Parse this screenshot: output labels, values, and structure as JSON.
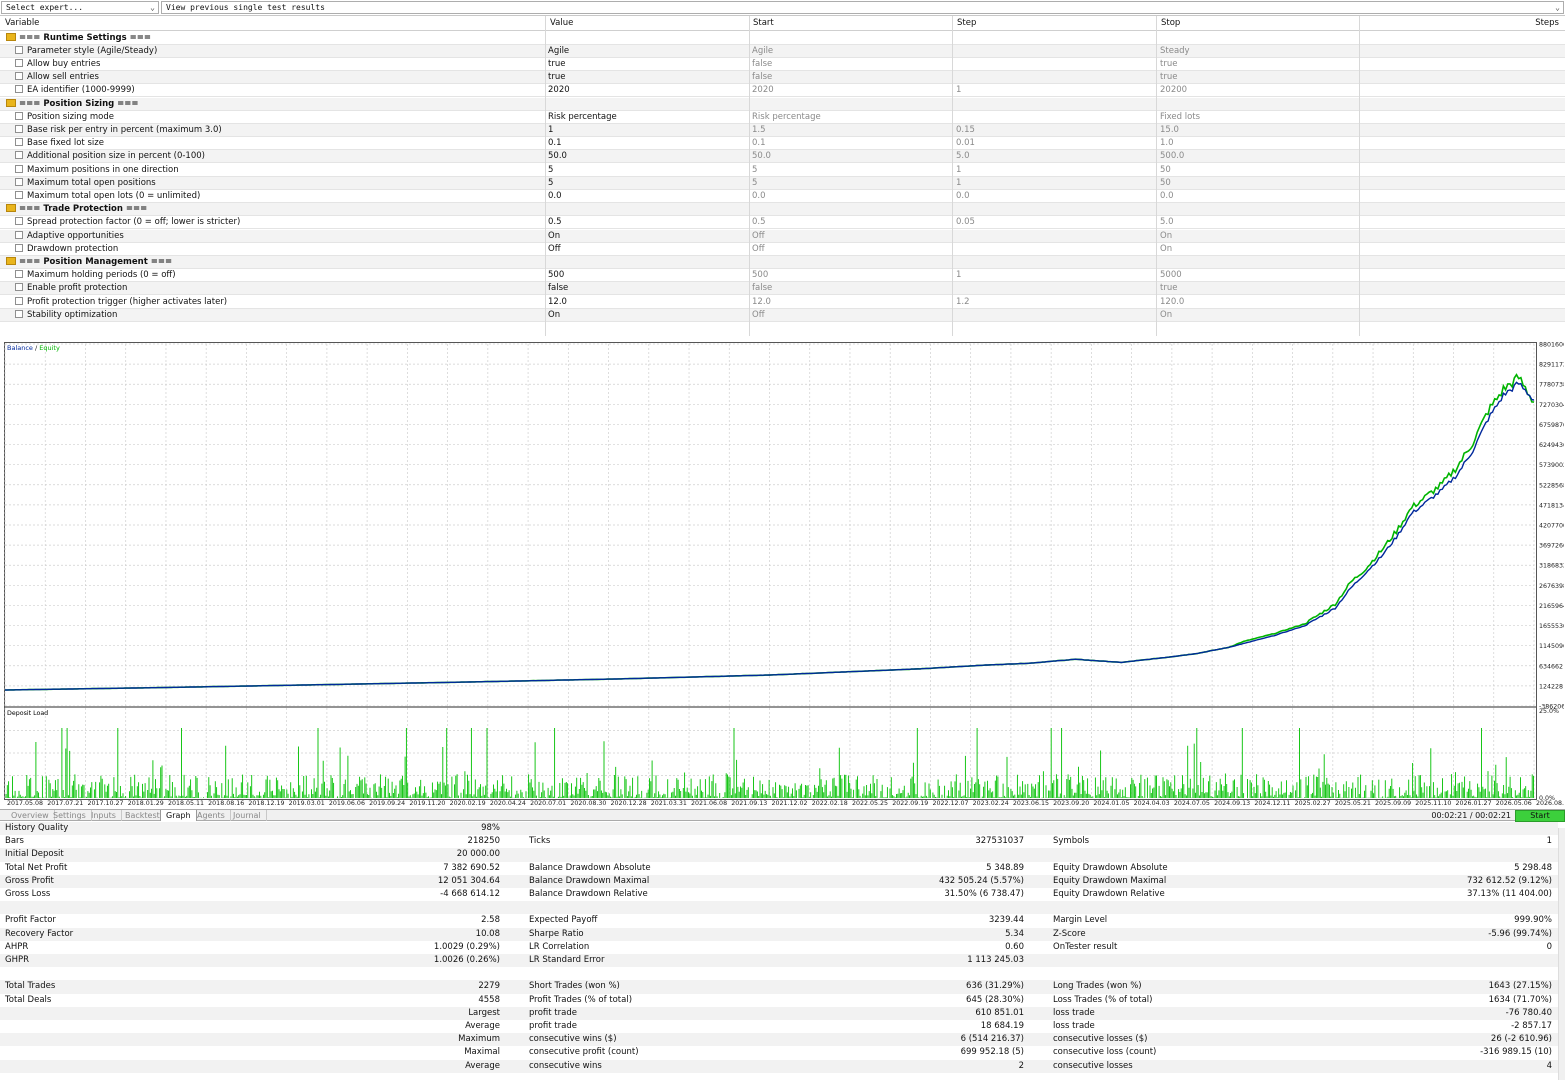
{
  "toolbar": {
    "expert_select": "Select expert...",
    "results_select": "View previous single test results"
  },
  "params": {
    "headers": {
      "variable": "Variable",
      "value": "Value",
      "start": "Start",
      "step": "Step",
      "stop": "Stop",
      "steps": "Steps"
    },
    "rows": [
      {
        "group": true,
        "label": "=== Runtime Settings ==="
      },
      {
        "label": "Parameter style (Agile/Steady)",
        "value": "Agile",
        "start": "Agile",
        "step": "",
        "stop": "Steady"
      },
      {
        "label": "Allow buy entries",
        "value": "true",
        "start": "false",
        "step": "",
        "stop": "true"
      },
      {
        "label": "Allow sell entries",
        "value": "true",
        "start": "false",
        "step": "",
        "stop": "true"
      },
      {
        "label": "EA identifier (1000-9999)",
        "value": "2020",
        "start": "2020",
        "step": "1",
        "stop": "20200"
      },
      {
        "group": true,
        "label": "=== Position Sizing ==="
      },
      {
        "label": "Position sizing mode",
        "value": "Risk percentage",
        "start": "Risk percentage",
        "step": "",
        "stop": "Fixed lots"
      },
      {
        "label": "Base risk per entry in percent (maximum 3.0)",
        "value": "1",
        "start": "1.5",
        "step": "0.15",
        "stop": "15.0"
      },
      {
        "label": "Base fixed lot size",
        "value": "0.1",
        "start": "0.1",
        "step": "0.01",
        "stop": "1.0"
      },
      {
        "label": "Additional position size in percent (0-100)",
        "value": "50.0",
        "start": "50.0",
        "step": "5.0",
        "stop": "500.0"
      },
      {
        "label": "Maximum positions in one direction",
        "value": "5",
        "start": "5",
        "step": "1",
        "stop": "50"
      },
      {
        "label": "Maximum total open positions",
        "value": "5",
        "start": "5",
        "step": "1",
        "stop": "50"
      },
      {
        "label": "Maximum total open lots (0 = unlimited)",
        "value": "0.0",
        "start": "0.0",
        "step": "0.0",
        "stop": "0.0"
      },
      {
        "group": true,
        "label": "=== Trade Protection ==="
      },
      {
        "label": "Spread protection factor (0 = off; lower is stricter)",
        "value": "0.5",
        "start": "0.5",
        "step": "0.05",
        "stop": "5.0"
      },
      {
        "label": "Adaptive opportunities",
        "value": "On",
        "start": "Off",
        "step": "",
        "stop": "On"
      },
      {
        "label": "Drawdown protection",
        "value": "Off",
        "start": "Off",
        "step": "",
        "stop": "On"
      },
      {
        "group": true,
        "label": "=== Position Management ==="
      },
      {
        "label": "Maximum holding periods (0 = off)",
        "value": "500",
        "start": "500",
        "step": "1",
        "stop": "5000"
      },
      {
        "label": "Enable profit protection",
        "value": "false",
        "start": "false",
        "step": "",
        "stop": "true"
      },
      {
        "label": "Profit protection trigger (higher activates later)",
        "value": "12.0",
        "start": "12.0",
        "step": "1.2",
        "stop": "120.0"
      },
      {
        "label": "Stability optimization",
        "value": "On",
        "start": "Off",
        "step": "",
        "stop": "On"
      }
    ]
  },
  "chart_data": [
    {
      "type": "line",
      "legend": [
        "Balance",
        "Equity"
      ],
      "colors": {
        "balance": "#00289b",
        "equity": "#00b400"
      },
      "y_ticks": [
        8801606,
        8291172,
        7780738,
        7270304,
        6759870,
        6249436,
        5739002,
        5228568,
        4718134,
        4207700,
        3697266,
        3186832,
        2676398,
        2165964,
        1655530,
        1145096,
        634662,
        124228,
        -386206
      ],
      "ylim": [
        -386206,
        8801606
      ],
      "x_ticks": [
        "2017.05.08",
        "2017.07.21",
        "2017.10.27",
        "2018.01.29",
        "2018.05.11",
        "2018.08.16",
        "2018.12.19",
        "2019.03.01",
        "2019.06.06",
        "2019.09.24",
        "2019.11.20",
        "2020.02.19",
        "2020.04.24",
        "2020.07.01",
        "2020.08.30",
        "2020.12.28",
        "2021.03.31",
        "2021.06.08",
        "2021.09.13",
        "2021.12.02",
        "2022.02.18",
        "2022.05.25",
        "2022.09.19",
        "2022.12.07",
        "2023.02.24",
        "2023.06.15",
        "2023.09.20",
        "2024.01.05",
        "2024.04.03",
        "2024.07.05",
        "2024.09.13",
        "2024.12.11",
        "2025.02.27",
        "2025.05.21",
        "2025.09.09",
        "2025.11.10",
        "2026.01.27",
        "2026.05.06",
        "2026.08.04"
      ],
      "x": [
        0,
        0.1,
        0.2,
        0.3,
        0.4,
        0.5,
        0.55,
        0.6,
        0.64,
        0.67,
        0.7,
        0.73,
        0.76,
        0.78,
        0.8,
        0.81,
        0.83,
        0.85,
        0.87,
        0.88,
        0.89,
        0.9,
        0.91,
        0.92,
        0.93,
        0.94,
        0.95,
        0.96,
        0.97,
        0.98,
        0.99,
        1
      ],
      "balance": [
        20000,
        80000,
        150000,
        220000,
        300000,
        400000,
        480000,
        560000,
        650000,
        700000,
        800000,
        720000,
        850000,
        950000,
        1100000,
        1200000,
        1400000,
        1650000,
        2100000,
        2600000,
        3000000,
        3400000,
        3900000,
        4500000,
        4800000,
        5100000,
        5500000,
        6100000,
        6900000,
        7500000,
        7800000,
        7382690
      ],
      "equity": [
        20000,
        80000,
        150000,
        220000,
        300000,
        400000,
        480000,
        560000,
        650000,
        700000,
        800000,
        720000,
        850000,
        950000,
        1100000,
        1250000,
        1450000,
        1700000,
        2200000,
        2750000,
        3100000,
        3550000,
        4050000,
        4650000,
        4950000,
        5250000,
        5700000,
        6300000,
        7100000,
        7650000,
        7950000,
        7330000
      ]
    },
    {
      "type": "bar",
      "title": "Deposit Load",
      "y_ticks": [
        "25.0%",
        "0.0%"
      ],
      "ylim": [
        0,
        25
      ]
    }
  ],
  "tabs": [
    "Overview",
    "Settings",
    "Inputs",
    "Backtest",
    "Graph",
    "Agents",
    "Journal"
  ],
  "active_tab": "Graph",
  "timer": "00:02:21 / 00:02:21",
  "start_label": "Start",
  "stats": [
    {
      "a": "History Quality",
      "av": "98%",
      "b": "",
      "bv": "",
      "c": "",
      "cv": ""
    },
    {
      "a": "Bars",
      "av": "218250",
      "b": "Ticks",
      "bv": "327531037",
      "c": "Symbols",
      "cv": "1"
    },
    {
      "a": "Initial Deposit",
      "av": "20 000.00",
      "b": "",
      "bv": "",
      "c": "",
      "cv": ""
    },
    {
      "a": "Total Net Profit",
      "av": "7 382 690.52",
      "b": "Balance Drawdown Absolute",
      "bv": "5 348.89",
      "c": "Equity Drawdown Absolute",
      "cv": "5 298.48"
    },
    {
      "a": "Gross Profit",
      "av": "12 051 304.64",
      "b": "Balance Drawdown Maximal",
      "bv": "432 505.24 (5.57%)",
      "c": "Equity Drawdown Maximal",
      "cv": "732 612.52 (9.12%)"
    },
    {
      "a": "Gross Loss",
      "av": "-4 668 614.12",
      "b": "Balance Drawdown Relative",
      "bv": "31.50% (6 738.47)",
      "c": "Equity Drawdown Relative",
      "cv": "37.13% (11 404.00)"
    },
    {
      "a": "",
      "av": "",
      "b": "",
      "bv": "",
      "c": "",
      "cv": ""
    },
    {
      "a": "Profit Factor",
      "av": "2.58",
      "b": "Expected Payoff",
      "bv": "3239.44",
      "c": "Margin Level",
      "cv": "999.90%"
    },
    {
      "a": "Recovery Factor",
      "av": "10.08",
      "b": "Sharpe Ratio",
      "bv": "5.34",
      "c": "Z-Score",
      "cv": "-5.96 (99.74%)"
    },
    {
      "a": "AHPR",
      "av": "1.0029 (0.29%)",
      "b": "LR Correlation",
      "bv": "0.60",
      "c": "OnTester result",
      "cv": "0"
    },
    {
      "a": "GHPR",
      "av": "1.0026 (0.26%)",
      "b": "LR Standard Error",
      "bv": "1 113 245.03",
      "c": "",
      "cv": ""
    },
    {
      "a": "",
      "av": "",
      "b": "",
      "bv": "",
      "c": "",
      "cv": ""
    },
    {
      "a": "Total Trades",
      "av": "2279",
      "b": "Short Trades (won %)",
      "bv": "636 (31.29%)",
      "c": "Long Trades (won %)",
      "cv": "1643 (27.15%)"
    },
    {
      "a": "Total Deals",
      "av": "4558",
      "b": "Profit Trades (% of total)",
      "bv": "645 (28.30%)",
      "c": "Loss Trades (% of total)",
      "cv": "1634 (71.70%)"
    },
    {
      "a": "",
      "av": "Largest",
      "b": "profit trade",
      "bv": "610 851.01",
      "c": "loss trade",
      "cv": "-76 780.40"
    },
    {
      "a": "",
      "av": "Average",
      "b": "profit trade",
      "bv": "18 684.19",
      "c": "loss trade",
      "cv": "-2 857.17"
    },
    {
      "a": "",
      "av": "Maximum",
      "b": "consecutive wins ($)",
      "bv": "6 (514 216.37)",
      "c": "consecutive losses ($)",
      "cv": "26 (-2 610.96)"
    },
    {
      "a": "",
      "av": "Maximal",
      "b": "consecutive profit (count)",
      "bv": "699 952.18 (5)",
      "c": "consecutive loss (count)",
      "cv": "-316 989.15 (10)"
    },
    {
      "a": "",
      "av": "Average",
      "b": "consecutive wins",
      "bv": "2",
      "c": "consecutive losses",
      "cv": "4"
    }
  ]
}
